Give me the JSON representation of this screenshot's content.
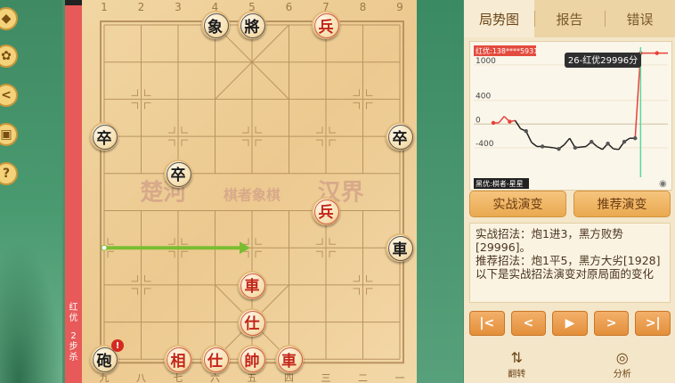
{
  "sidebar": {
    "buttons": [
      {
        "name": "diamond-icon",
        "glyph": "◆"
      },
      {
        "name": "gear-icon",
        "glyph": "✿"
      },
      {
        "name": "share-icon",
        "glyph": "<"
      },
      {
        "name": "board-icon",
        "glyph": "▣"
      },
      {
        "name": "help-icon",
        "glyph": "?"
      }
    ]
  },
  "status_bar": {
    "side": "红优",
    "steps": "2步杀"
  },
  "board": {
    "file_numbers_top": [
      "1",
      "2",
      "3",
      "4",
      "5",
      "6",
      "7",
      "8",
      "9"
    ],
    "file_numbers_bottom": [
      "九",
      "八",
      "七",
      "六",
      "五",
      "四",
      "三",
      "二",
      "一"
    ],
    "river_left": "楚河",
    "river_center": "棋者象棋",
    "river_right": "汉界",
    "pieces": [
      {
        "char": "象",
        "color": "black",
        "file": 3,
        "rank": 0
      },
      {
        "char": "將",
        "color": "black",
        "file": 4,
        "rank": 0
      },
      {
        "char": "兵",
        "color": "red",
        "file": 6,
        "rank": 0
      },
      {
        "char": "卒",
        "color": "black",
        "file": 0,
        "rank": 3
      },
      {
        "char": "卒",
        "color": "black",
        "file": 8,
        "rank": 3
      },
      {
        "char": "卒",
        "color": "black",
        "file": 2,
        "rank": 4
      },
      {
        "char": "兵",
        "color": "red",
        "file": 6,
        "rank": 5
      },
      {
        "char": "車",
        "color": "black",
        "file": 8,
        "rank": 6
      },
      {
        "char": "車",
        "color": "red",
        "file": 4,
        "rank": 7
      },
      {
        "char": "仕",
        "color": "red",
        "file": 4,
        "rank": 8
      },
      {
        "char": "砲",
        "color": "black",
        "file": 0,
        "rank": 9
      },
      {
        "char": "相",
        "color": "red",
        "file": 2,
        "rank": 9
      },
      {
        "char": "仕",
        "color": "red",
        "file": 3,
        "rank": 9
      },
      {
        "char": "帥",
        "color": "red",
        "file": 4,
        "rank": 9
      },
      {
        "char": "車",
        "color": "red",
        "file": 5,
        "rank": 9
      }
    ],
    "alert_glyph": "!",
    "move_arrow": {
      "from_file": 0,
      "to_file": 4,
      "rank": 6
    }
  },
  "panel": {
    "tabs": [
      "局势图",
      "报告",
      "错误"
    ],
    "chart_label_top": "红优:138****5931",
    "chart_label_bottom": "黑优:棋者-星星",
    "tooltip": "26-红优29996分",
    "eye_icon": "◉",
    "actions": [
      "实战演变",
      "推荐演变"
    ],
    "analysis_lines": [
      "实战招法：炮1进3，黑方败势[29996]。",
      "推荐招法：炮1平5，黑方大劣[1928]",
      "以下是实战招法演变对原局面的变化"
    ],
    "nav": [
      "|<",
      "<",
      "▶",
      ">",
      ">|"
    ],
    "bottom": [
      {
        "icon": "⇅",
        "label": "翻转"
      },
      {
        "icon": "◎",
        "label": "分析"
      }
    ]
  },
  "chart_data": {
    "type": "line",
    "ylabel": "",
    "yticks": [
      "1000",
      "400",
      "0",
      "-400"
    ],
    "ylim": [
      -900,
      1300
    ],
    "x": [
      0,
      1,
      2,
      3,
      4,
      5,
      6,
      7,
      8,
      9,
      10,
      11,
      12,
      13,
      14,
      15,
      16,
      17,
      18,
      19,
      20,
      21,
      22,
      23,
      24,
      25,
      26,
      27,
      28,
      29,
      30,
      31,
      32
    ],
    "values": [
      20,
      20,
      130,
      40,
      60,
      -80,
      -120,
      -310,
      -380,
      -380,
      -390,
      -400,
      -420,
      -350,
      -240,
      -400,
      -390,
      -380,
      -300,
      -380,
      -430,
      -330,
      -420,
      -430,
      -300,
      -240,
      -240,
      29996,
      29996,
      29996,
      29996,
      29996,
      29996
    ],
    "clip_top": 1200,
    "highlight_index": 26,
    "colors": {
      "positive": "#e8413a",
      "negative": "#222222",
      "marker": "#555555",
      "highlight": "#5cd6a0"
    }
  }
}
